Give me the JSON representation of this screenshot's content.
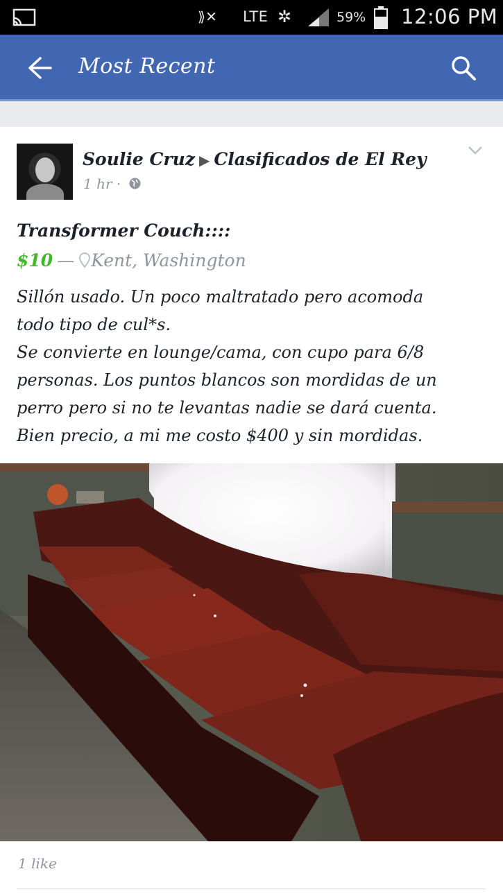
{
  "status_bar": {
    "network": "LTE",
    "battery": "59%",
    "time": "12:06 PM",
    "icons": [
      "cast-icon",
      "mute-icon",
      "signal-activity-icon",
      "signal-icon",
      "battery-icon"
    ]
  },
  "app_bar": {
    "title": "Most Recent",
    "back_icon": "back-arrow-icon",
    "search_icon": "search-icon",
    "color": "#4267b2"
  },
  "post": {
    "author": "Soulie Cruz",
    "group": "Clasificados de El Rey",
    "time": "1 hr ·",
    "privacy_icon": "globe-icon",
    "item_title": "Transformer Couch::::",
    "price": "$10",
    "dash": "—",
    "location": "Kent, Washington",
    "body_lines": [
      "Sillón usado.  Un poco maltratado pero acomoda",
      "todo tipo de cul*s.",
      "Se convierte en lounge/cama, con cupo para 6/8",
      "personas.  Los puntos blancos son mordidas de un",
      "perro pero si no te levantas nadie se dará cuenta.",
      "Bien precio, a mi me costo $400 y sin mordidas."
    ],
    "likes": "1 like"
  },
  "colors": {
    "price": "#42b72a",
    "secondary_text": "#90949c",
    "couch": "#6b1f16"
  }
}
